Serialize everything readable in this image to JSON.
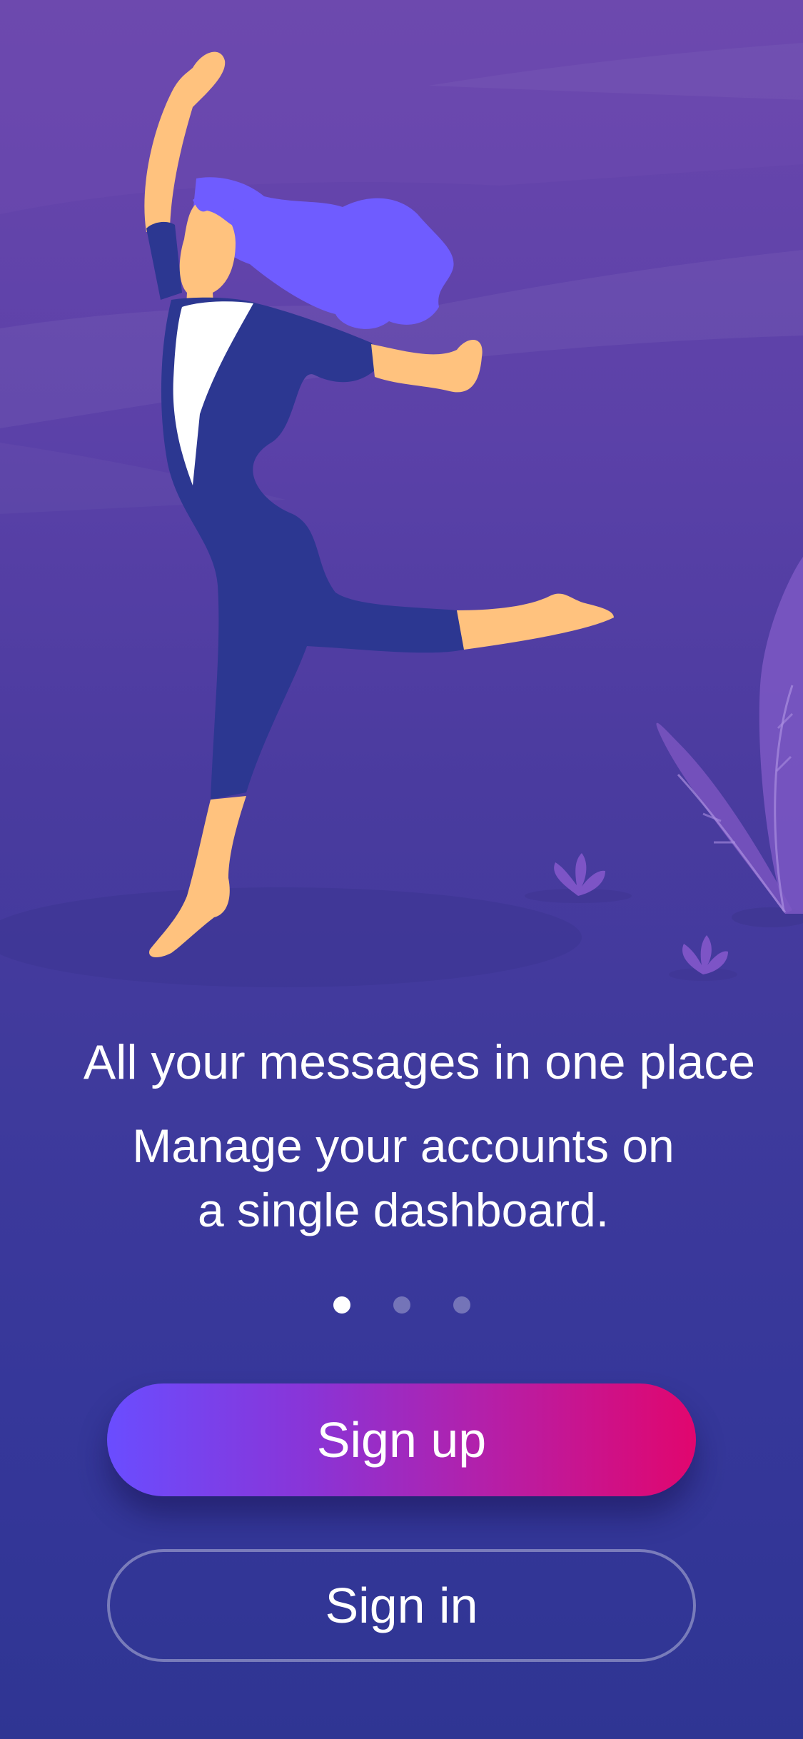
{
  "onboarding": {
    "headline": "All your messages in one place",
    "subtext_line1": "Manage your accounts on",
    "subtext_line2": "a single dashboard.",
    "pages": {
      "count": 3,
      "active": 1
    }
  },
  "actions": {
    "signup_label": "Sign up",
    "signin_label": "Sign in"
  },
  "icons": [
    "dancing-woman-illustration",
    "plant-illustration",
    "small-plant-illustration"
  ],
  "colors": {
    "background_top": "#6b47ad",
    "background_bottom": "#2f3593",
    "signup_gradient_start": "#6a4dff",
    "signup_gradient_end": "#e1066e",
    "skin": "#ffc27e",
    "hair": "#6f5cff",
    "dress": "#2b3691"
  }
}
